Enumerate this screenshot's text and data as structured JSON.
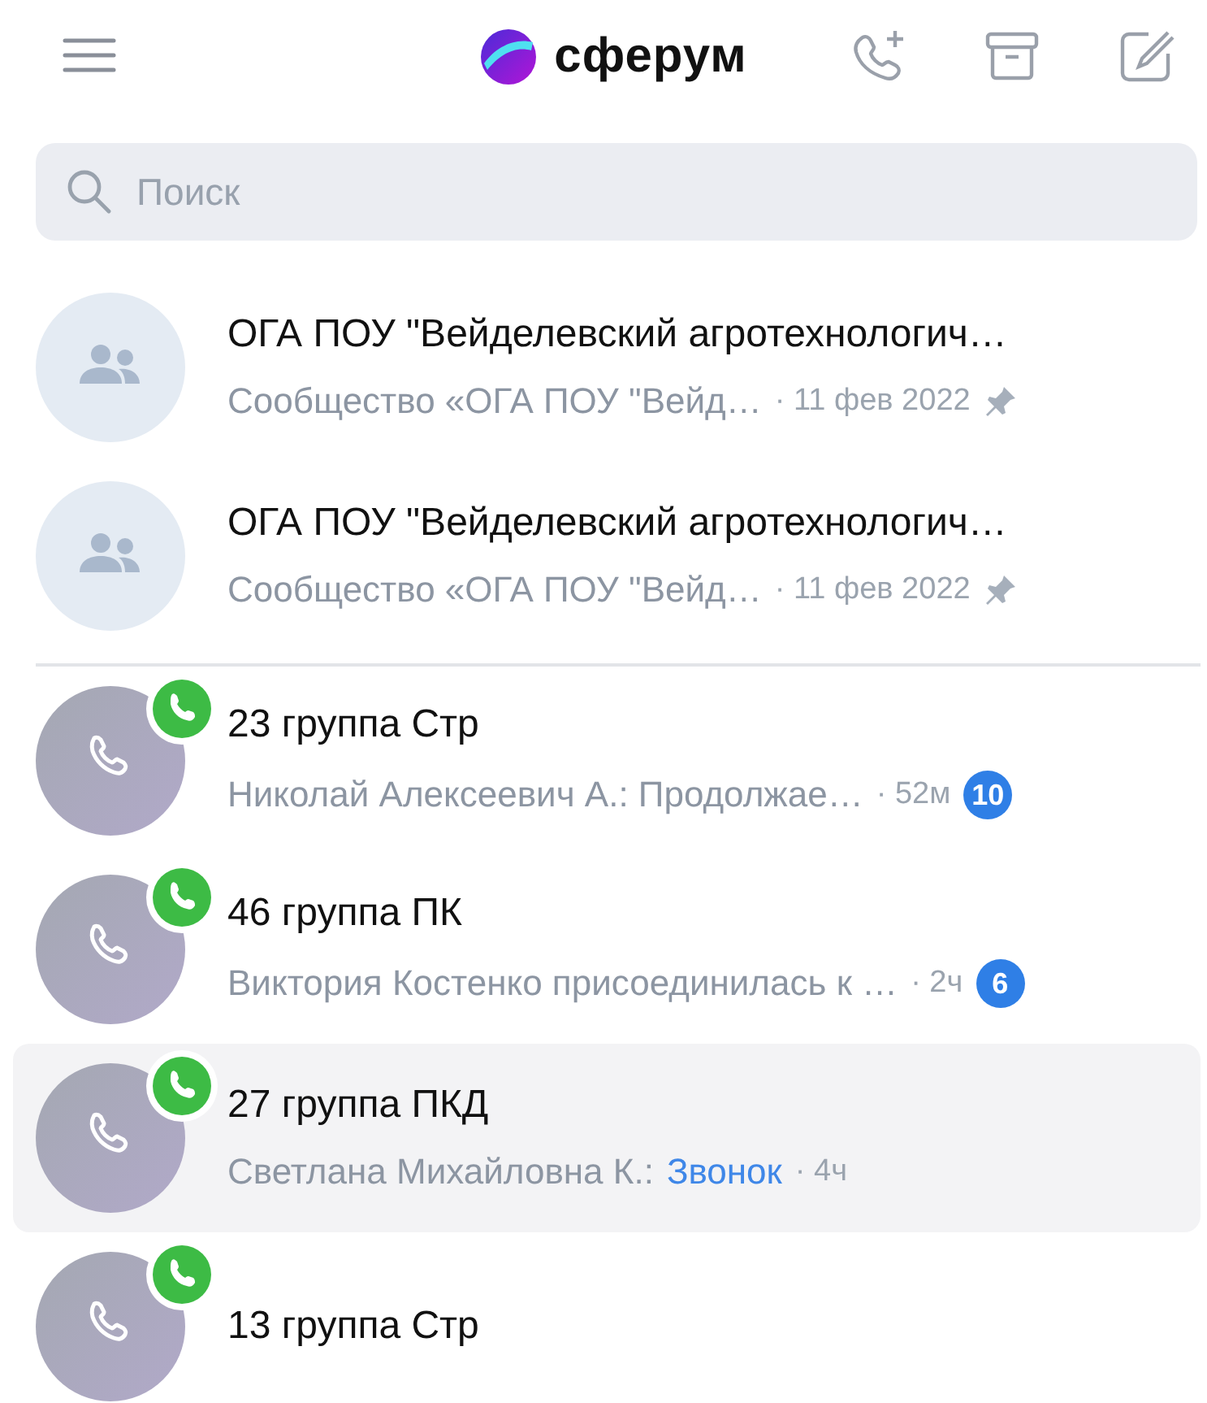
{
  "header": {
    "logo_text": "сферум"
  },
  "search": {
    "placeholder": "Поиск"
  },
  "pinned_chats": [
    {
      "title": "ОГА ПОУ \"Вейделевский агротехнологич…",
      "preview": "Сообщество «ОГА ПОУ \"Вейд…",
      "time": "· 11 фев 2022",
      "pinned": true
    },
    {
      "title": "ОГА ПОУ \"Вейделевский агротехнологич…",
      "preview": "Сообщество «ОГА ПОУ \"Вейд…",
      "time": "· 11 фев 2022",
      "pinned": true
    }
  ],
  "chats": [
    {
      "title": "23 группа Стр",
      "preview": "Николай Алексеевич А.: Продолжае…",
      "time": "· 52м",
      "unread": "10",
      "call_active": true,
      "selected": false
    },
    {
      "title": "46 группа ПК",
      "preview": "Виктория Костенко присоединилась к …",
      "time": "· 2ч",
      "unread": "6",
      "call_active": true,
      "selected": false
    },
    {
      "title": "27 группа ПКД",
      "preview": "Светлана Михайловна К.:",
      "link": "Звонок",
      "time": "· 4ч",
      "call_active": true,
      "selected": true
    },
    {
      "title": "13 группа Стр",
      "call_active": true,
      "selected": false
    }
  ]
}
